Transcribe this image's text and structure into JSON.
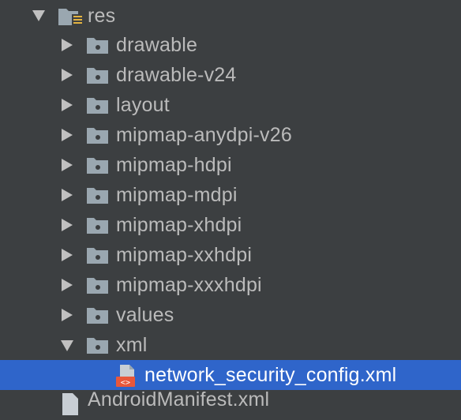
{
  "tree": {
    "root": {
      "label": "res",
      "expanded": true,
      "icon": "res-folder-icon"
    },
    "children": [
      {
        "label": "drawable",
        "expanded": false,
        "icon": "folder-icon"
      },
      {
        "label": "drawable-v24",
        "expanded": false,
        "icon": "folder-icon"
      },
      {
        "label": "layout",
        "expanded": false,
        "icon": "folder-icon"
      },
      {
        "label": "mipmap-anydpi-v26",
        "expanded": false,
        "icon": "folder-icon"
      },
      {
        "label": "mipmap-hdpi",
        "expanded": false,
        "icon": "folder-icon"
      },
      {
        "label": "mipmap-mdpi",
        "expanded": false,
        "icon": "folder-icon"
      },
      {
        "label": "mipmap-xhdpi",
        "expanded": false,
        "icon": "folder-icon"
      },
      {
        "label": "mipmap-xxhdpi",
        "expanded": false,
        "icon": "folder-icon"
      },
      {
        "label": "mipmap-xxxhdpi",
        "expanded": false,
        "icon": "folder-icon"
      },
      {
        "label": "values",
        "expanded": false,
        "icon": "folder-icon"
      },
      {
        "label": "xml",
        "expanded": true,
        "icon": "folder-icon"
      }
    ],
    "selected_file": {
      "label": "network_security_config.xml",
      "icon": "xml-file-icon",
      "selected": true
    },
    "partial_next": {
      "label": "AndroidManifest.xml",
      "icon": "manifest-file-icon"
    }
  },
  "colors": {
    "background": "#3c3f41",
    "text": "#bbbbbb",
    "selection": "#2f65ca",
    "folder": "#9aa7b0",
    "xml_badge": "#e8573b"
  }
}
